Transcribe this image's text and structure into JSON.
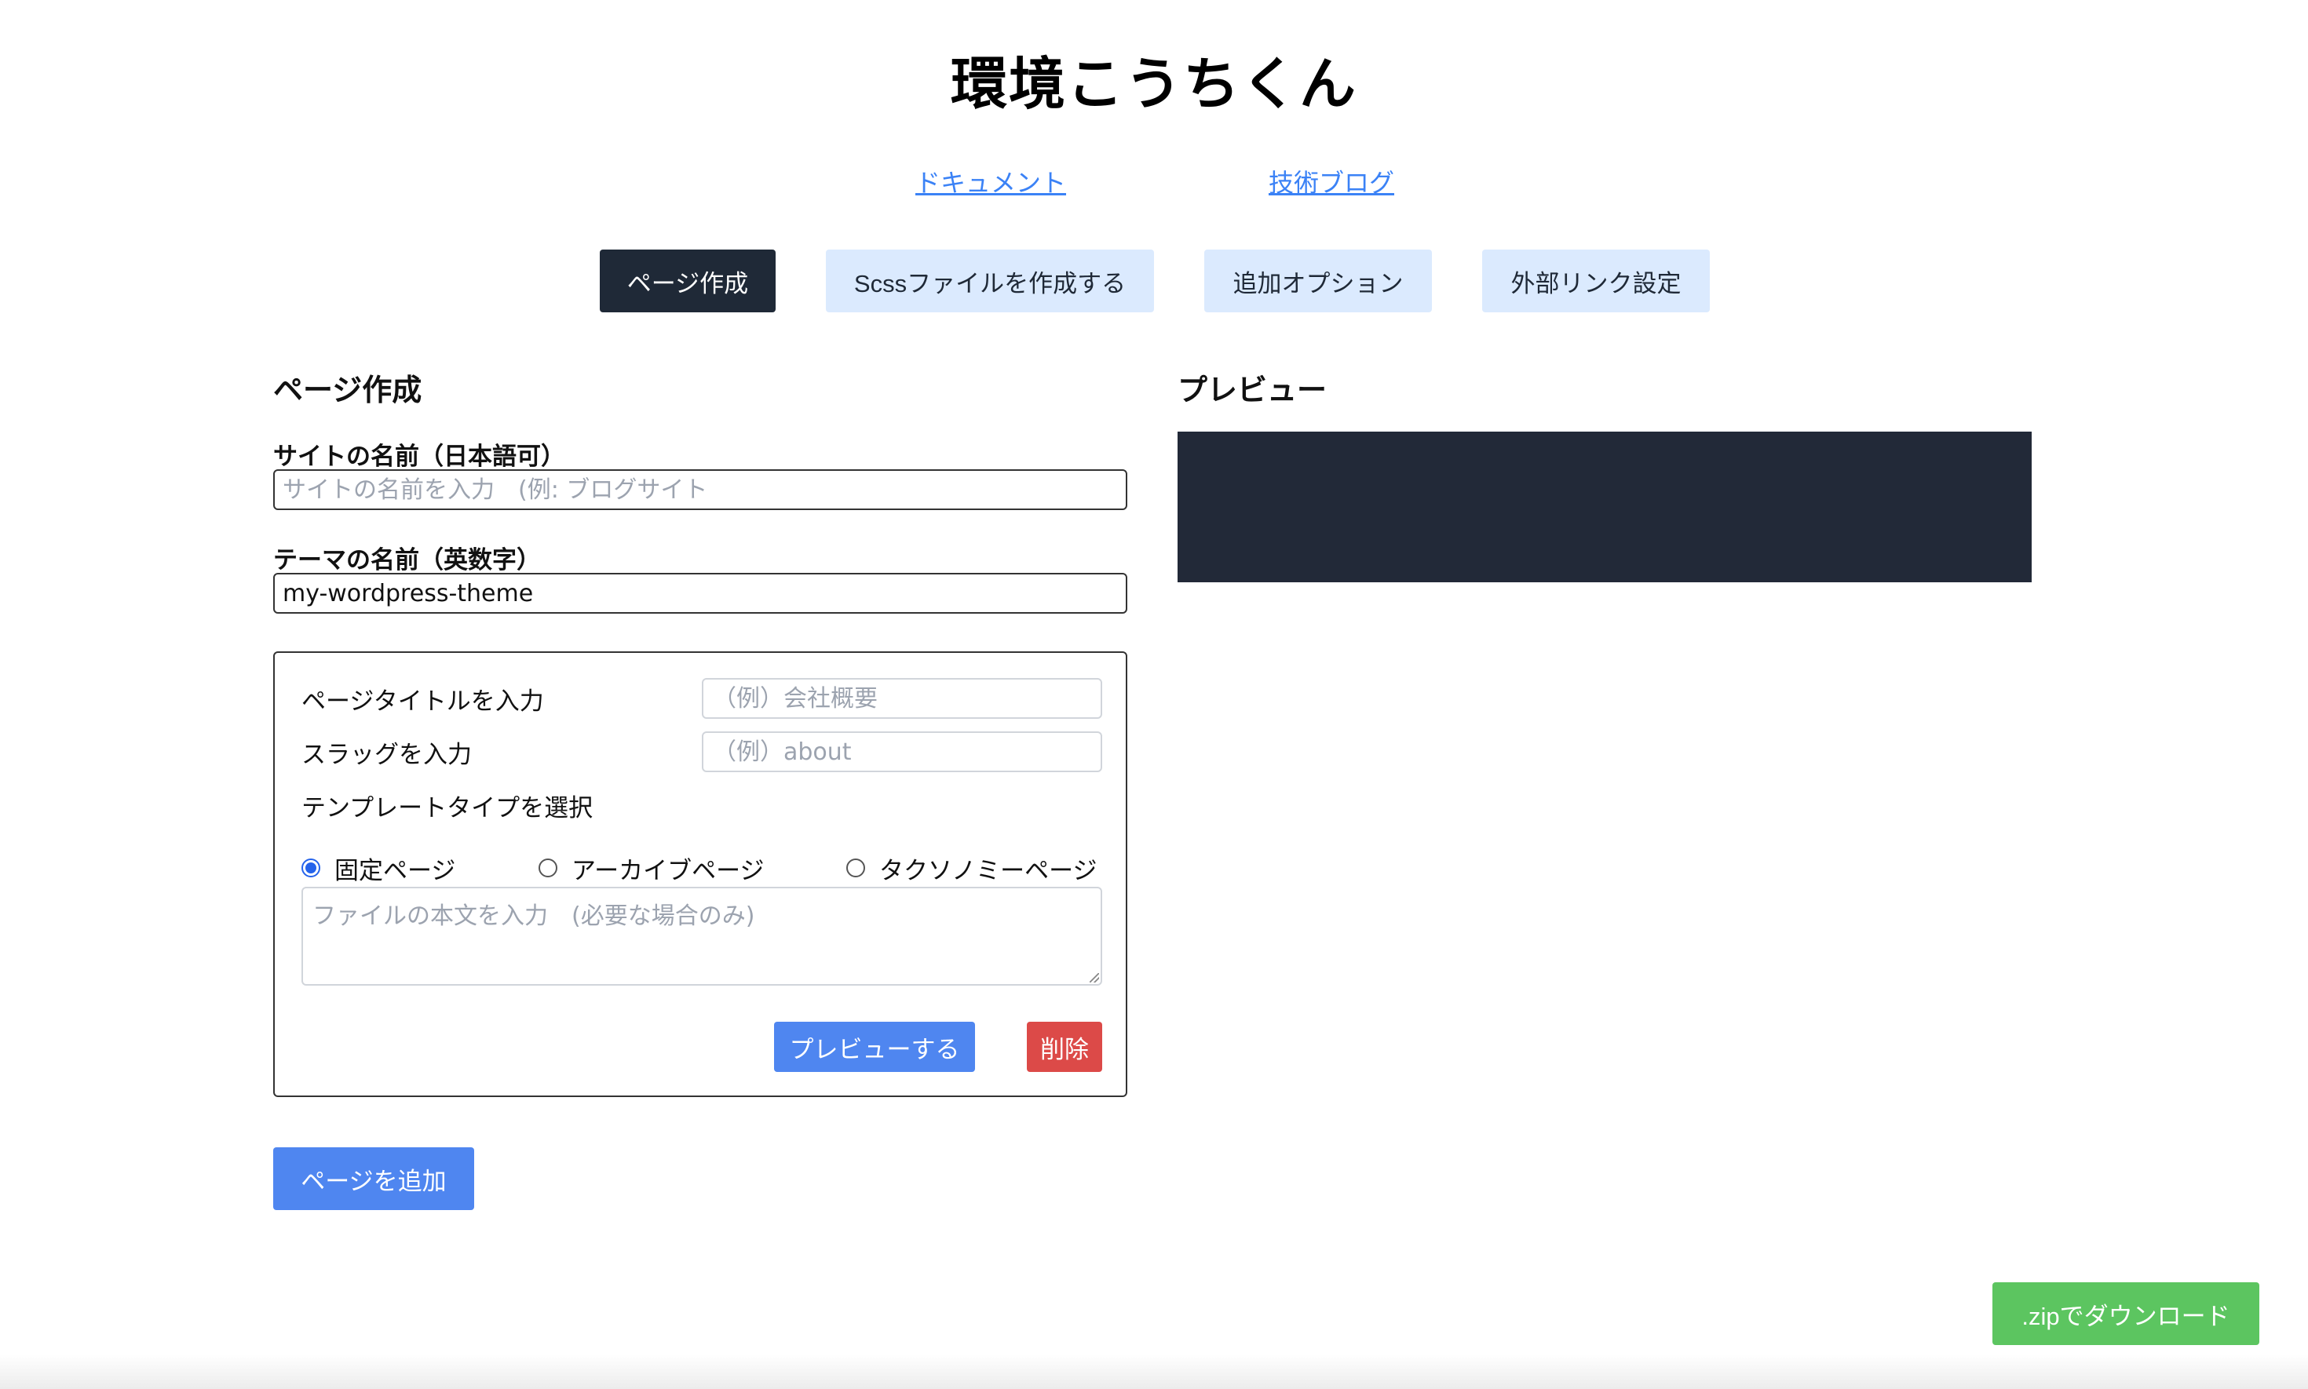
{
  "app": {
    "title": "環境こうちくん"
  },
  "nav_links": [
    {
      "label": "ドキュメント"
    },
    {
      "label": "技術ブログ"
    }
  ],
  "tabs": [
    {
      "label": "ページ作成",
      "active": true
    },
    {
      "label": "Scssファイルを作成する",
      "active": false
    },
    {
      "label": "追加オプション",
      "active": false
    },
    {
      "label": "外部リンク設定",
      "active": false
    }
  ],
  "form": {
    "section_title": "ページ作成",
    "site_name": {
      "label": "サイトの名前（日本語可）",
      "placeholder": "サイトの名前を入力　(例: ブログサイト",
      "value": ""
    },
    "theme_name": {
      "label": "テーマの名前（英数字）",
      "placeholder": "",
      "value": "my-wordpress-theme"
    },
    "page_card": {
      "title_label": "ページタイトルを入力",
      "title_placeholder": "（例）会社概要",
      "slug_label": "スラッグを入力",
      "slug_placeholder": "（例）about",
      "template_label": "テンプレートタイプを選択",
      "template_options": [
        {
          "label": "固定ページ",
          "checked": true
        },
        {
          "label": "アーカイブページ",
          "checked": false
        },
        {
          "label": "タクソノミーページ",
          "checked": false
        }
      ],
      "body_placeholder": "ファイルの本文を入力　(必要な場合のみ)",
      "preview_button": "プレビューする",
      "delete_button": "削除"
    },
    "add_page_button": "ページを追加"
  },
  "preview": {
    "title": "プレビュー"
  },
  "download_button": ".zipでダウンロード",
  "colors": {
    "accent": "#4f86f0",
    "danger": "#dc4a48",
    "success": "#5cc560",
    "dark": "#1f2937",
    "tab_inactive": "#dbeafe",
    "link": "#3b82f6"
  }
}
